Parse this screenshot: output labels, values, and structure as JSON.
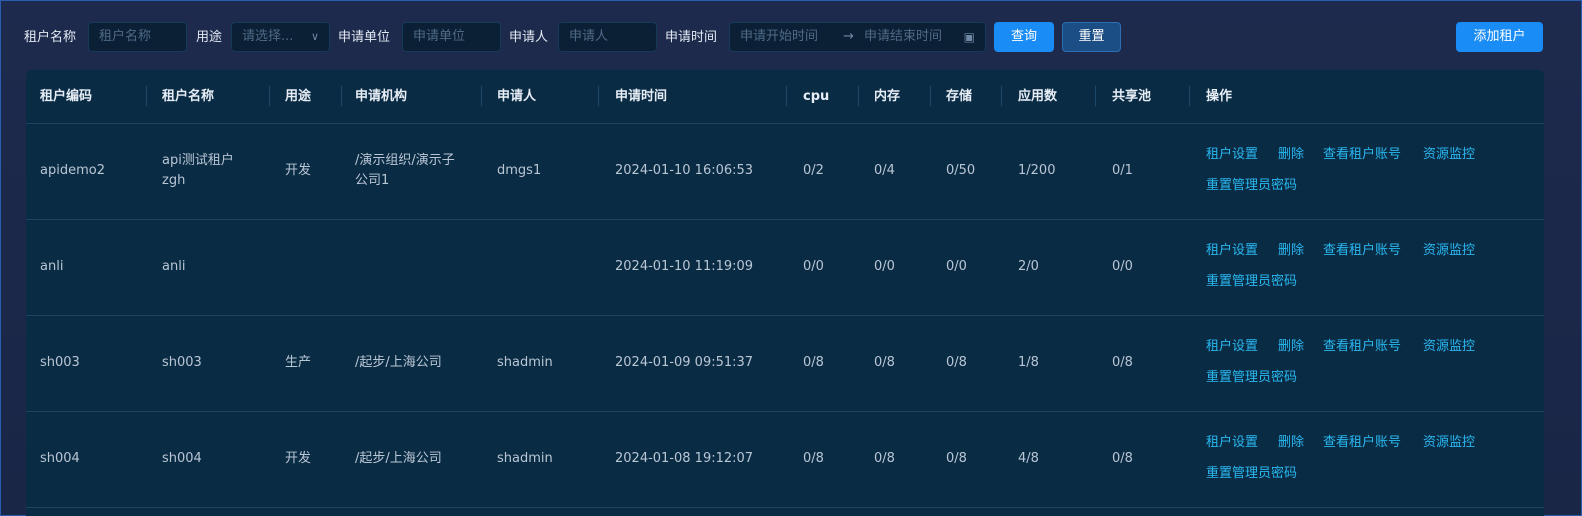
{
  "filters": {
    "tenant_name_label": "租户名称",
    "tenant_name_placeholder": "租户名称",
    "purpose_label": "用途",
    "purpose_placeholder": "请选择...",
    "apply_unit_label": "申请单位",
    "apply_unit_placeholder": "申请单位",
    "applicant_label": "申请人",
    "applicant_placeholder": "申请人",
    "apply_time_label": "申请时间",
    "start_placeholder": "申请开始时间",
    "range_arrow": "→",
    "end_placeholder": "申请结束时间",
    "query_label": "查询",
    "reset_label": "重置",
    "add_label": "添加租户"
  },
  "table": {
    "headers": [
      "租户编码",
      "租户名称",
      "用途",
      "申请机构",
      "申请人",
      "申请时间",
      "cpu",
      "内存",
      "存储",
      "应用数",
      "共享池",
      "操作"
    ],
    "actions": {
      "settings": "租户设置",
      "delete": "删除",
      "view_accounts": "查看租户账号",
      "monitor": "资源监控",
      "reset_password": "重置管理员密码"
    },
    "rows": [
      {
        "code": "apidemo2",
        "name_line1": "api测试租户",
        "name_line2": "zgh",
        "purpose": "开发",
        "org_line1": "/演示组织/演示子",
        "org_line2": "公司1",
        "applicant": "dmgs1",
        "time": "2024-01-10 16:06:53",
        "cpu": "0/2",
        "mem": "0/4",
        "storage": "0/50",
        "apps": "1/200",
        "pool": "0/1"
      },
      {
        "code": "anli",
        "name_line1": "anli",
        "name_line2": "",
        "purpose": "",
        "org_line1": "",
        "org_line2": "",
        "applicant": "",
        "time": "2024-01-10 11:19:09",
        "cpu": "0/0",
        "mem": "0/0",
        "storage": "0/0",
        "apps": "2/0",
        "pool": "0/0"
      },
      {
        "code": "sh003",
        "name_line1": "sh003",
        "name_line2": "",
        "purpose": "生产",
        "org_line1": "/起步/上海公司",
        "org_line2": "",
        "applicant": "shadmin",
        "time": "2024-01-09 09:51:37",
        "cpu": "0/8",
        "mem": "0/8",
        "storage": "0/8",
        "apps": "1/8",
        "pool": "0/8"
      },
      {
        "code": "sh004",
        "name_line1": "sh004",
        "name_line2": "",
        "purpose": "开发",
        "org_line1": "/起步/上海公司",
        "org_line2": "",
        "applicant": "shadmin",
        "time": "2024-01-08 19:12:07",
        "cpu": "0/8",
        "mem": "0/8",
        "storage": "0/8",
        "apps": "4/8",
        "pool": "0/8"
      }
    ]
  },
  "colors": {
    "background": "#1a2748",
    "table_bg": "#0a2b44",
    "link": "#29b8f0",
    "primary_button": "#1a8cf5"
  }
}
